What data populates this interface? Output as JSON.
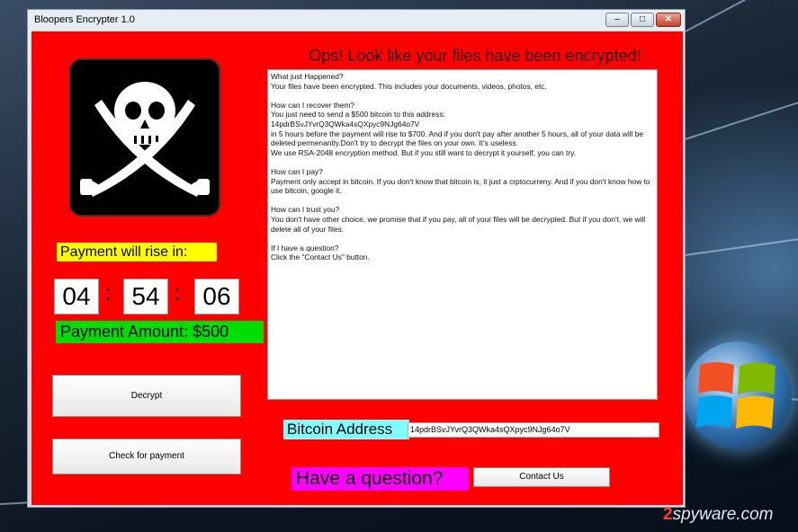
{
  "window": {
    "title": "Bloopers Encrypter 1.0"
  },
  "heading": "Ops! Look like your files have been encrypted!",
  "note": {
    "paragraphs": [
      "What just Happened?\nYour files have been encrypted. This includes your documents, videos, photos, etc.",
      "How can I recover them?\nYou just need to send a $500 bitcoin to this address:\n14pdrBSvJYvrQ3QWka4sQXpyc9NJg64o7V\nin 5 hours before the payment will rise to $700. And if you don't pay after another 5 hours, all of your data will be deleted permenantly.Don't try to decrypt the files on your own. It's useless.\nWe use RSA-2048 encryption method. But if you still want to decrypt it yourself, you can try.",
      "How can I pay?\nPayment only accept in bitcoin. If you don't know that bitcoin is, it just a crptocurreny. And if you don't know how to use bitcoin, google it.",
      "How can I trust you?\nYou don't have other choice, we promise that if you pay, all of your files will be decrypted. But if you don't, we will delete all of your files.",
      "If I have a question?\nClick the \"Contact Us\" button."
    ]
  },
  "timer": {
    "label": "Payment will rise in:",
    "hours": "04",
    "minutes": "54",
    "seconds": "06",
    "separator": ":"
  },
  "payment_amount": "Payment Amount: $500",
  "buttons": {
    "decrypt": "Decrypt",
    "check_payment": "Check for payment",
    "contact": "Contact Us"
  },
  "bitcoin": {
    "label": "Bitcoin Address",
    "address": "14pdrBSvJYvrQ3QWka4sQXpyc9NJg64o7V"
  },
  "question_label": "Have a question?",
  "watermark": {
    "prefix": "2",
    "text": "spyware",
    "suffix": ".com"
  },
  "colors": {
    "background": "#ff0000",
    "timer_label": "#ffff00",
    "amount": "#00dd00",
    "bitcoin_label": "#7fffff",
    "question": "#ff00ff"
  },
  "icons": {
    "logo": "skull-crossed-swords-icon",
    "windows_logo": "windows-logo-icon"
  }
}
